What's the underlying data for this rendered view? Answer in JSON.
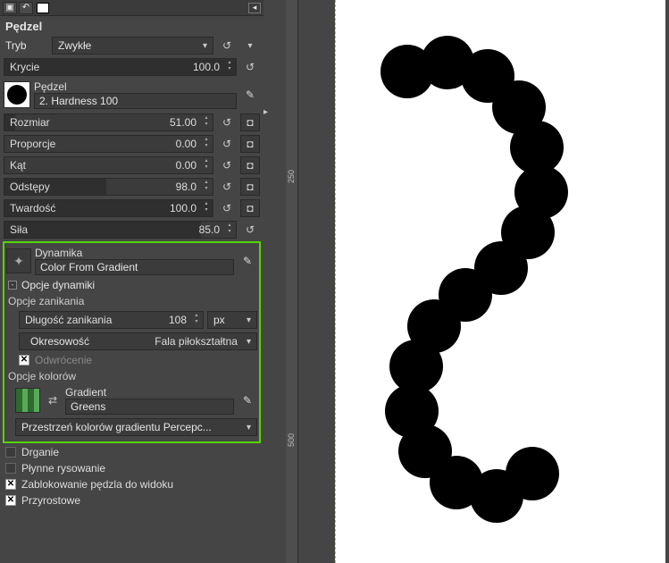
{
  "title": "Pędzel",
  "mode": {
    "label": "Tryb",
    "value": "Zwykłe"
  },
  "opacity": {
    "label": "Krycie",
    "value": "100.0"
  },
  "brush": {
    "heading": "Pędzel",
    "name": "2. Hardness 100"
  },
  "sliders": {
    "size": {
      "label": "Rozmiar",
      "value": "51.00"
    },
    "aspect": {
      "label": "Proporcje",
      "value": "0.00"
    },
    "angle": {
      "label": "Kąt",
      "value": "0.00"
    },
    "spacing": {
      "label": "Odstępy",
      "value": "98.0"
    },
    "hardness": {
      "label": "Twardość",
      "value": "100.0"
    },
    "force": {
      "label": "Siła",
      "value": "85.0"
    }
  },
  "dynamics": {
    "heading": "Dynamika",
    "name": "Color From Gradient"
  },
  "dyn_options_label": "Opcje dynamiki",
  "fade": {
    "heading": "Opcje zanikania",
    "length_label": "Długość zanikania",
    "length_value": "108",
    "unit": "px",
    "period_label": "Okresowość",
    "period_value": "Fala piłokształtna",
    "reverse": "Odwrócenie"
  },
  "color_options": {
    "heading": "Opcje kolorów",
    "grad_heading": "Gradient",
    "grad_name": "Greens",
    "space": "Przestrzeń kolorów gradientu Percepc..."
  },
  "checks": {
    "jitter": "Drganie",
    "smooth": "Płynne rysowanie",
    "lock": "Zablokowanie pędzla do widoku",
    "inc": "Przyrostowe"
  },
  "ruler": {
    "t1": "250",
    "t2": "500"
  }
}
